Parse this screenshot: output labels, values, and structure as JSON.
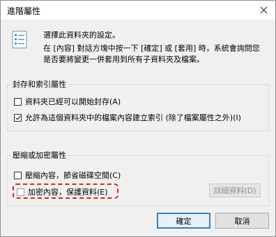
{
  "window": {
    "title": "進階屬性"
  },
  "header": {
    "line1": "選擇此資料夾的設定。",
    "line2": "在 [內容] 對話方塊中按一下 [確定] 或 [套用] 時，系統會詢問您是否要將變更一併套用到所有子資料夾及檔案。"
  },
  "archive_group": {
    "title": "封存和索引屬性",
    "items": [
      {
        "label": "資料夾已經可以開始封存(A)",
        "checked": false
      },
      {
        "label": "允許為這個資料夾中的檔案內容建立索引 (除了檔案屬性之外)(I)",
        "checked": true
      }
    ]
  },
  "compress_group": {
    "title": "壓縮或加密屬性",
    "items": [
      {
        "label": "壓縮內容，節省磁碟空間(C)",
        "checked": false
      },
      {
        "label": "加密內容，保護資料(E)",
        "checked": false
      }
    ],
    "details_label": "詳細資料(D)"
  },
  "buttons": {
    "ok": "確定",
    "cancel": "取消"
  },
  "colors": {
    "highlight": "#e02020",
    "ok_border": "#3c7fb1"
  }
}
